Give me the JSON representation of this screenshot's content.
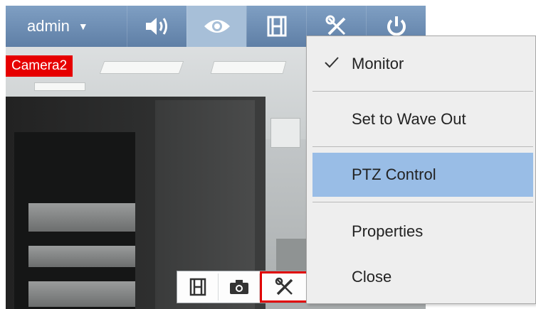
{
  "toolbar": {
    "user_label": "admin",
    "buttons": [
      {
        "icon": "speaker-icon",
        "active": false
      },
      {
        "icon": "eye-icon",
        "active": true
      },
      {
        "icon": "film-icon",
        "active": false
      },
      {
        "icon": "tools-icon",
        "active": false
      },
      {
        "icon": "power-icon",
        "active": false
      }
    ],
    "bg_color": "#6f8fb6",
    "active_color": "#a7bfd8"
  },
  "camera": {
    "label": "Camera2",
    "label_color": "#e60000"
  },
  "mini_toolbar": {
    "buttons": [
      {
        "icon": "film-icon"
      },
      {
        "icon": "camera-icon"
      },
      {
        "icon": "tools-icon",
        "highlighted": true
      }
    ],
    "highlight_color": "#e00000"
  },
  "context_menu": {
    "items": [
      {
        "label": "Monitor",
        "checked": true,
        "hover": false
      },
      {
        "label": "Set to Wave Out",
        "checked": false,
        "hover": false
      },
      {
        "label": "PTZ Control",
        "checked": false,
        "hover": true
      },
      {
        "label": "Properties",
        "checked": false,
        "hover": false
      },
      {
        "label": "Close",
        "checked": false,
        "hover": false
      }
    ],
    "hover_color": "#99bde6"
  }
}
